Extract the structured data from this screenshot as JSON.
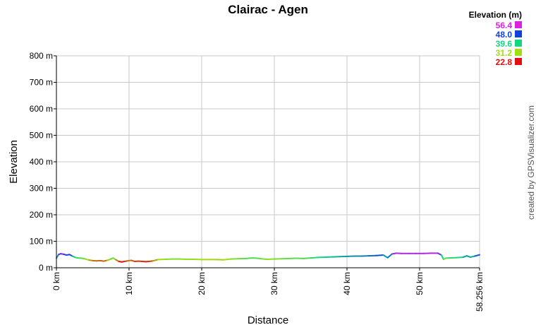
{
  "chart_data": {
    "type": "line",
    "title": "Clairac - Agen",
    "xlabel": "Distance",
    "ylabel": "Elevation",
    "xlim": [
      0,
      58.256
    ],
    "ylim": [
      0,
      800
    ],
    "x_unit": "km",
    "y_unit": "m",
    "x_ticks": [
      "0 km",
      "10 km",
      "20 km",
      "30 km",
      "40 km",
      "50 km",
      "58.256 km"
    ],
    "y_ticks": [
      "0 m",
      "100 m",
      "200 m",
      "300 m",
      "400 m",
      "500 m",
      "600 m",
      "700 m",
      "800 m"
    ],
    "grid": true,
    "legend_placement": "top-right",
    "legend": {
      "title": "Elevation (m)",
      "entries": [
        {
          "label": "56.4",
          "color": "#e020e0"
        },
        {
          "label": "48.0",
          "color": "#1040e0"
        },
        {
          "label": "39.6",
          "color": "#10d880"
        },
        {
          "label": "31.2",
          "color": "#a0e010"
        },
        {
          "label": "22.8",
          "color": "#e01010"
        }
      ]
    },
    "series": [
      {
        "x": [
          0,
          0.3,
          0.6,
          1.0,
          1.4,
          1.8,
          2.2,
          2.6,
          3.0,
          3.5,
          4.0,
          4.5,
          5.0,
          5.5,
          6.0,
          6.5,
          7.0,
          7.5,
          7.8,
          8.2,
          8.6,
          9.0,
          9.4,
          9.8,
          10.3,
          10.8,
          11.3,
          11.8,
          12.3,
          12.8,
          13.3,
          14.0,
          15.0,
          16.0,
          17.0,
          18.0,
          19.0,
          20.0,
          21.0,
          22.0,
          23.0,
          24.0,
          25.0,
          26.0,
          27.0,
          27.6,
          28.2,
          29.0,
          30.0,
          31.0,
          32.0,
          33.0,
          34.0,
          35.0,
          36.0,
          37.0,
          38.0,
          39.0,
          40.0,
          41.0,
          42.0,
          43.0,
          44.0,
          45.0,
          45.6,
          46.2,
          46.8,
          47.5,
          48.5,
          49.5,
          50.5,
          51.5,
          52.5,
          53.0,
          53.3,
          53.6,
          54.0,
          55.0,
          56.0,
          56.5,
          57.0,
          57.6,
          58.256
        ],
        "y": [
          36,
          50,
          53,
          51,
          48,
          50,
          44,
          39,
          37,
          36,
          33,
          29,
          27,
          26,
          27,
          25,
          28,
          33,
          37,
          30,
          24,
          22,
          24,
          26,
          28,
          24,
          25,
          24,
          23,
          24,
          26,
          31,
          32,
          33,
          33,
          32,
          32,
          31,
          31,
          31,
          30,
          33,
          34,
          35,
          37,
          36,
          34,
          32,
          33,
          34,
          35,
          36,
          35,
          37,
          39,
          40,
          41,
          42,
          43,
          44,
          44,
          45,
          46,
          48,
          38,
          52,
          55,
          54,
          54,
          54,
          54,
          55,
          55,
          48,
          32,
          36,
          37,
          38,
          40,
          45,
          40,
          44,
          49
        ]
      }
    ]
  },
  "credit": "created by GPSVisualizer.com",
  "colors": {
    "grid": "#c8c8c8",
    "axis": "#000000",
    "credit": "#555555"
  }
}
